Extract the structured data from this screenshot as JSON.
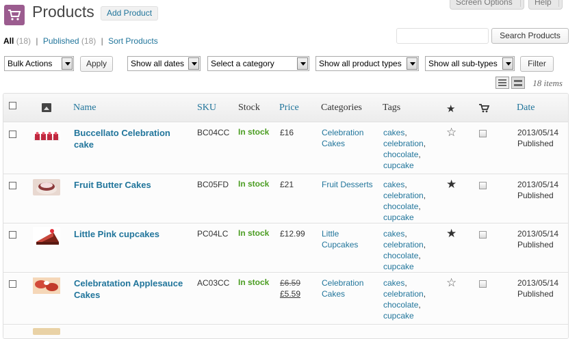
{
  "header": {
    "title": "Products",
    "add_label": "Add Product",
    "screen_options": "Screen Options",
    "help": "Help"
  },
  "views": [
    {
      "label": "All",
      "count": "(18)",
      "current": true
    },
    {
      "label": "Published",
      "count": "(18)"
    },
    {
      "label": "Sort Products",
      "count": ""
    }
  ],
  "search": {
    "button": "Search Products",
    "value": ""
  },
  "filters": {
    "bulk_actions": "Bulk Actions",
    "apply": "Apply",
    "dates": "Show all dates",
    "category": "Select a category",
    "product_types": "Show all product types",
    "sub_types": "Show all sub-types",
    "filter": "Filter"
  },
  "items_count": "18 items",
  "columns": {
    "name": "Name",
    "sku": "SKU",
    "stock": "Stock",
    "price": "Price",
    "categories": "Categories",
    "tags": "Tags",
    "date": "Date"
  },
  "rows": [
    {
      "name": "Buccellato Celebration cake",
      "sku": "BC04CC",
      "stock": "In stock",
      "price": "£16",
      "price_sale": "",
      "category": "Celebration Cakes",
      "tags": [
        "cakes",
        "celebration",
        "chocolate",
        "cupcake"
      ],
      "featured": false,
      "date": "2013/05/14",
      "status": "Published",
      "thumb_color": "#c0283f"
    },
    {
      "name": "Fruit Butter Cakes",
      "sku": "BC05FD",
      "stock": "In stock",
      "price": "£21",
      "price_sale": "",
      "category": "Fruit Desserts",
      "tags": [
        "cakes",
        "celebration",
        "chocolate",
        "cupcake"
      ],
      "featured": true,
      "date": "2013/05/14",
      "status": "Published",
      "thumb_color": "#b5736b"
    },
    {
      "name": "Little Pink cupcakes",
      "sku": "PC04LC",
      "stock": "In stock",
      "price": "£12.99",
      "price_sale": "",
      "category": "Little Cupcakes",
      "tags": [
        "cakes",
        "celebration",
        "chocolate",
        "cupcake"
      ],
      "featured": true,
      "date": "2013/05/14",
      "status": "Published",
      "thumb_color": "#8a2b20"
    },
    {
      "name": "Celebratation Applesauce Cakes",
      "sku": "AC03CC",
      "stock": "In stock",
      "price": "£6.59",
      "price_sale": "£5.59",
      "category": "Celebration Cakes",
      "tags": [
        "cakes",
        "celebration",
        "chocolate",
        "cupcake"
      ],
      "featured": false,
      "date": "2013/05/14",
      "status": "Published",
      "thumb_color": "#d24a3a"
    }
  ],
  "colors": {
    "link": "#21759b",
    "in_stock": "#4b9d22",
    "icon_bg": "#9b5c8f"
  }
}
